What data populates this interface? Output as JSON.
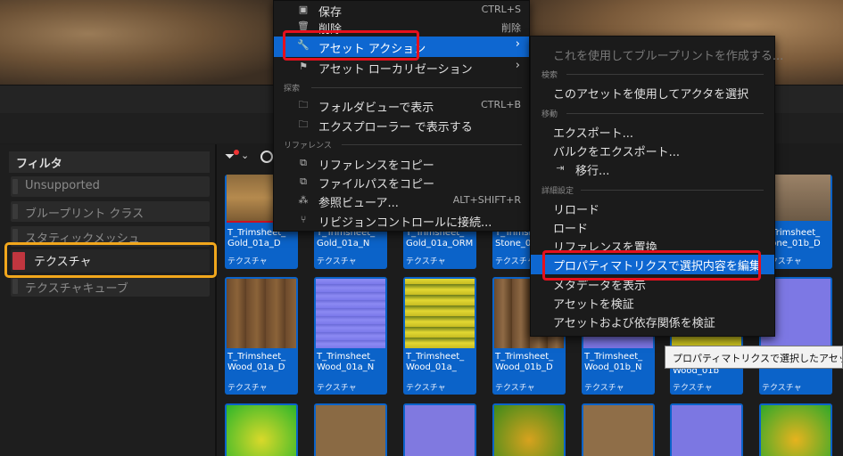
{
  "main_menu": {
    "items_top": [
      {
        "label": "保存",
        "shortcut": "CTRL+S",
        "icon": "save-icon"
      },
      {
        "label": "削除",
        "shortcut": "削除",
        "icon": "trash-icon"
      },
      {
        "label": "アセット アクション",
        "icon": "wrench-icon"
      },
      {
        "label": "アセット ローカリゼーション",
        "icon": "flag-icon"
      }
    ],
    "section_search": "探索",
    "items_search": [
      {
        "label": "フォルダビューで表示",
        "shortcut": "CTRL+B",
        "icon": "folder-search-icon"
      },
      {
        "label": "エクスプローラー で表示する",
        "icon": "folder-search-icon"
      }
    ],
    "section_ref": "リファレンス",
    "items_ref": [
      {
        "label": "リファレンスをコピー",
        "icon": "copy-icon"
      },
      {
        "label": "ファイルパスをコピー",
        "icon": "copy-icon"
      },
      {
        "label": "参照ビューア...",
        "shortcut": "ALT+SHIFT+R",
        "icon": "reference-viewer-icon"
      },
      {
        "label": "リビジョンコントロールに接続...",
        "icon": "branch-icon"
      }
    ]
  },
  "sub_menu": {
    "first": "これを使用してブループリントを作成する...",
    "section_search": "検索",
    "select_actor": "このアセットを使用してアクタを選択",
    "section_move": "移動",
    "export": "エクスポート...",
    "bulk_export": "バルクをエクスポート...",
    "migrate": "移行...",
    "section_advanced": "詳細設定",
    "reload": "リロード",
    "load": "ロード",
    "replace_refs": "リファレンスを置換",
    "edit_property_matrix": "プロパティマトリクスで選択内容を編集",
    "show_metadata": "メタデータを表示",
    "validate": "アセットを検証",
    "validate_deps": "アセットおよび依存関係を検証"
  },
  "tooltip": "プロパティマトリクスで選択したアセット",
  "filter": {
    "title": "フィルタ",
    "items": [
      "Unsupported",
      "ブループリント クラス",
      "スタティックメッシュ",
      "テクスチャ",
      "テクスチャキューブ"
    ]
  },
  "assets_row1": [
    {
      "name": "T_Trimsheet_\nGold_01a_D",
      "type": "テクスチャ"
    },
    {
      "name": "T_Trimsheet_\nGold_01a_N",
      "type": "テクスチャ"
    },
    {
      "name": "T_Trimsheet_\nGold_01a_ORM",
      "type": "テクスチャ"
    },
    {
      "name": "T_Trimsheet_\nStone_01a_D",
      "type": "テクスチャ"
    },
    {
      "name": "T_Trimsheet_\nStone_01b_D",
      "type": "テクスチャ"
    }
  ],
  "assets_row2": [
    {
      "name": "T_Trimsheet_\nWood_01a_D",
      "type": "テクスチャ"
    },
    {
      "name": "T_Trimsheet_\nWood_01a_N",
      "type": "テクスチャ"
    },
    {
      "name": "T_Trimsheet_\nWood_01a_",
      "type": "テクスチャ"
    },
    {
      "name": "T_Trimsheet_\nWood_01b_D",
      "type": "テクスチャ"
    },
    {
      "name": "T_Trimsheet_\nWood_01b_N",
      "type": "テクスチャ"
    },
    {
      "name": "Wood_01b",
      "type": "テクスチャ"
    },
    {
      "name": "",
      "type": "テクスチャ"
    }
  ]
}
